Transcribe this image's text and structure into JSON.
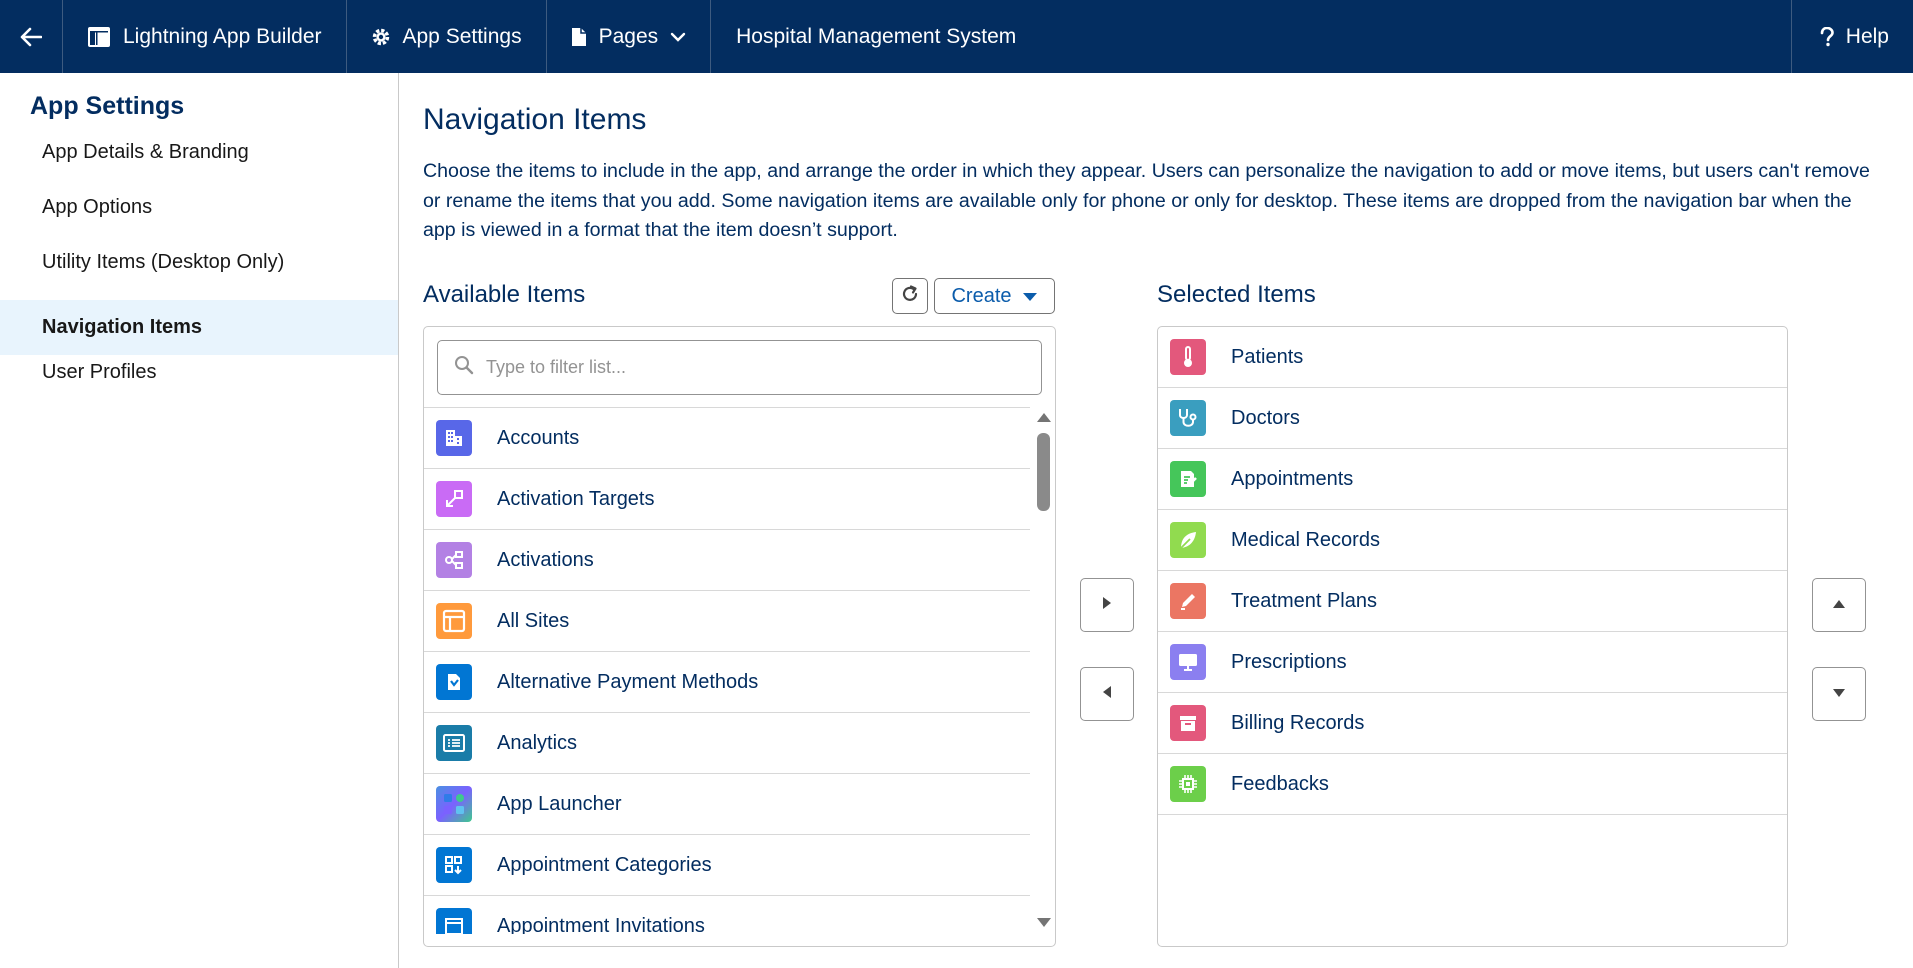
{
  "topbar": {
    "back_label": "Back",
    "builder_label": "Lightning App Builder",
    "settings_label": "App Settings",
    "pages_label": "Pages",
    "app_title": "Hospital Management System",
    "help_label": "Help"
  },
  "sidebar": {
    "heading": "App Settings",
    "items": [
      {
        "label": "App Details & Branding"
      },
      {
        "label": "App Options"
      },
      {
        "label": "Utility Items (Desktop Only)"
      },
      {
        "label": "Navigation Items",
        "active": true
      },
      {
        "label": "User Profiles"
      }
    ]
  },
  "main": {
    "title": "Navigation Items",
    "description": "Choose the items to include in the app, and arrange the order in which they appear. Users can personalize the navigation to add or move items, but users can't remove or rename the items that you add. Some navigation items are available only for phone or only for desktop. These items are dropped from the navigation bar when the app is viewed in a format that the item doesn’t support.",
    "available_title": "Available Items",
    "create_label": "Create",
    "filter_placeholder": "Type to filter list...",
    "selected_title": "Selected Items",
    "available_items": [
      {
        "label": "Accounts",
        "icon": "building-icon",
        "color": "#5867e8"
      },
      {
        "label": "Activation Targets",
        "icon": "target-icon",
        "color": "#c96bf5"
      },
      {
        "label": "Activations",
        "icon": "flow-icon",
        "color": "#b381e4"
      },
      {
        "label": "All Sites",
        "icon": "site-icon",
        "color": "#ff9a3c"
      },
      {
        "label": "Alternative Payment Methods",
        "icon": "payment-icon",
        "color": "#0176d3"
      },
      {
        "label": "Analytics",
        "icon": "analytics-icon",
        "color": "#1a7ca8"
      },
      {
        "label": "App Launcher",
        "icon": "app-launcher-icon",
        "color": "#4a90e2"
      },
      {
        "label": "Appointment Categories",
        "icon": "categories-icon",
        "color": "#0176d3"
      },
      {
        "label": "Appointment Invitations",
        "icon": "calendar-icon",
        "color": "#0176d3"
      }
    ],
    "selected_items": [
      {
        "label": "Patients",
        "icon": "thermometer-icon",
        "color": "#e3587c"
      },
      {
        "label": "Doctors",
        "icon": "stethoscope-icon",
        "color": "#3a9ebf"
      },
      {
        "label": "Appointments",
        "icon": "form-icon",
        "color": "#45c65a"
      },
      {
        "label": "Medical Records",
        "icon": "leaf-icon",
        "color": "#91db4f"
      },
      {
        "label": "Treatment Plans",
        "icon": "pencil-icon",
        "color": "#eb7663"
      },
      {
        "label": "Prescriptions",
        "icon": "monitor-icon",
        "color": "#8b7ff0"
      },
      {
        "label": "Billing Records",
        "icon": "archive-icon",
        "color": "#e3587c"
      },
      {
        "label": "Feedbacks",
        "icon": "chip-icon",
        "color": "#6ccf4a"
      }
    ]
  }
}
